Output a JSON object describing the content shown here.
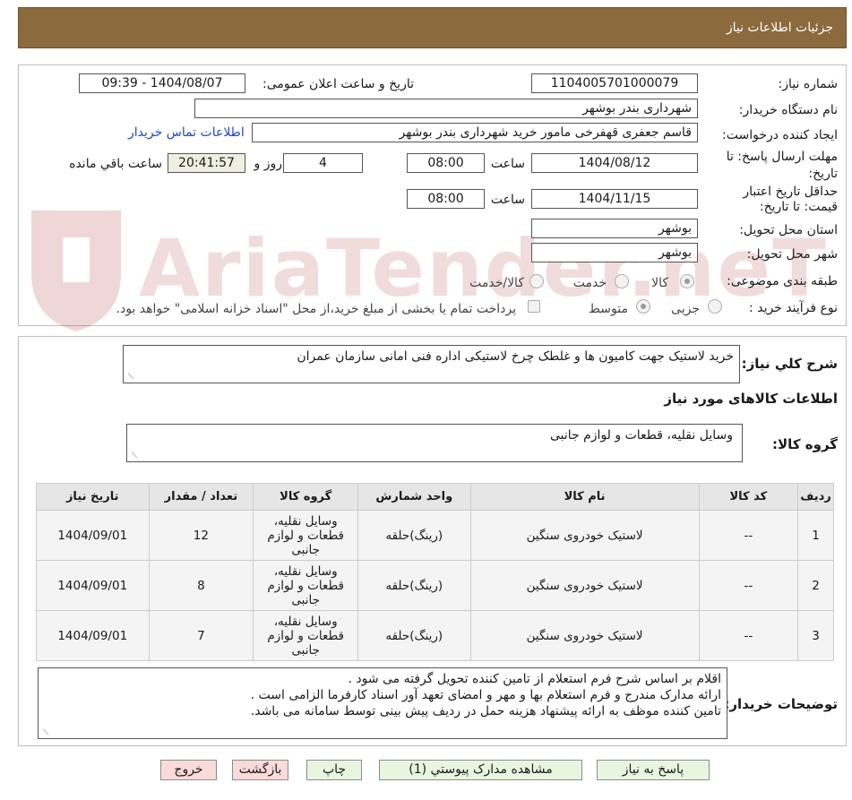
{
  "header": {
    "title": "جزئیات اطلاعات نیاز"
  },
  "watermark": {
    "text": "AriaTender.neT"
  },
  "form": {
    "need_number_label": "شماره نیاز:",
    "need_number": "1104005701000079",
    "announce_label": "تاریخ و ساعت اعلان عمومی:",
    "announce_value": "1404/08/07 - 09:39",
    "buyer_org_label": "نام دستگاه خریدار:",
    "buyer_org": "شهرداری بندر بوشهر",
    "requester_label": "ایجاد کننده درخواست:",
    "requester": "قاسم جعفری قهفرخی مامور خرید  شهرداری بندر بوشهر",
    "contact_link": "اطلاعات تماس خریدار",
    "deadline_label": "مهلت ارسال پاسخ: تا تاریخ:",
    "deadline_date": "1404/08/12",
    "time_label": "ساعت",
    "deadline_time": "08:00",
    "days_count": "4",
    "days_label": "روز و",
    "remaining_time": "20:41:57",
    "remaining_label": "ساعت باقي مانده",
    "validity_label": "حداقل تاریخ اعتبار قیمت: تا تاریخ:",
    "validity_date": "1404/11/15",
    "validity_time": "08:00",
    "province_label": "استان محل تحویل:",
    "province": "بوشهر",
    "city_label": "شهر محل تحویل:",
    "city": "بوشهر",
    "category_label": "طبقه بندی موضوعی:",
    "category_options": [
      "کالا",
      "خدمت",
      "کالا/خدمت"
    ],
    "process_label": "نوع فرآیند خرید :",
    "process_options": [
      "جزیی",
      "متوسط"
    ],
    "payment_note": "پرداخت تمام یا بخشی از مبلغ خرید،از محل \"اسناد خزانه اسلامی\" خواهد بود."
  },
  "summary": {
    "label": "شرح کلي نياز:",
    "text": "خرید لاستیک جهت کامیون ها و غلطک چرخ لاستیکی اداره فنی امانی سازمان عمران",
    "items_title": "اطلاعات کالاهای مورد نیاز",
    "group_label": "گروه کالا:",
    "group_value": "وسایل نقلیه، قطعات و لوازم جانبی"
  },
  "table": {
    "headers": [
      "ردیف",
      "کد کالا",
      "نام کالا",
      "واحد شمارش",
      "گروه کالا",
      "تعداد / مقدار",
      "تاریخ نیاز"
    ],
    "rows": [
      {
        "row": "1",
        "code": "--",
        "name": "لاستیک خودروی سنگین",
        "unit": "(رینگ)حلقه",
        "group": "وسایل نقلیه، قطعات و لوازم جانبی",
        "qty": "12",
        "date": "1404/09/01"
      },
      {
        "row": "2",
        "code": "--",
        "name": "لاستیک خودروی سنگین",
        "unit": "(رینگ)حلقه",
        "group": "وسایل نقلیه، قطعات و لوازم جانبی",
        "qty": "8",
        "date": "1404/09/01"
      },
      {
        "row": "3",
        "code": "--",
        "name": "لاستیک خودروی سنگین",
        "unit": "(رینگ)حلقه",
        "group": "وسایل نقلیه، قطعات و لوازم جانبی",
        "qty": "7",
        "date": "1404/09/01"
      }
    ]
  },
  "notes": {
    "label": "توضیحات خریدار:",
    "lines": [
      "اقلام بر اساس شرح فرم استعلام از تامین کننده تحویل گرفته می شود .",
      "ارائه مدارک مندرج و فرم استعلام بها و مهر و امضای تعهد آور اسناد کارفرما الزامی است .",
      "تامین  کننده موظف به ارائه پیشنهاد هزینه حمل در ردیف پیش بینی توسط سامانه می باشد."
    ]
  },
  "buttons": {
    "reply": "پاسخ به نیاز",
    "attachments": "مشاهده مدارک پیوستي (1)",
    "print": "چاپ",
    "back": "بازگشت",
    "exit": "خروج"
  },
  "colors": {
    "header_bg": "#8B6A3E",
    "link": "#1f49c7",
    "green_button": "#e8f6df",
    "pink_button": "#fbdada"
  }
}
